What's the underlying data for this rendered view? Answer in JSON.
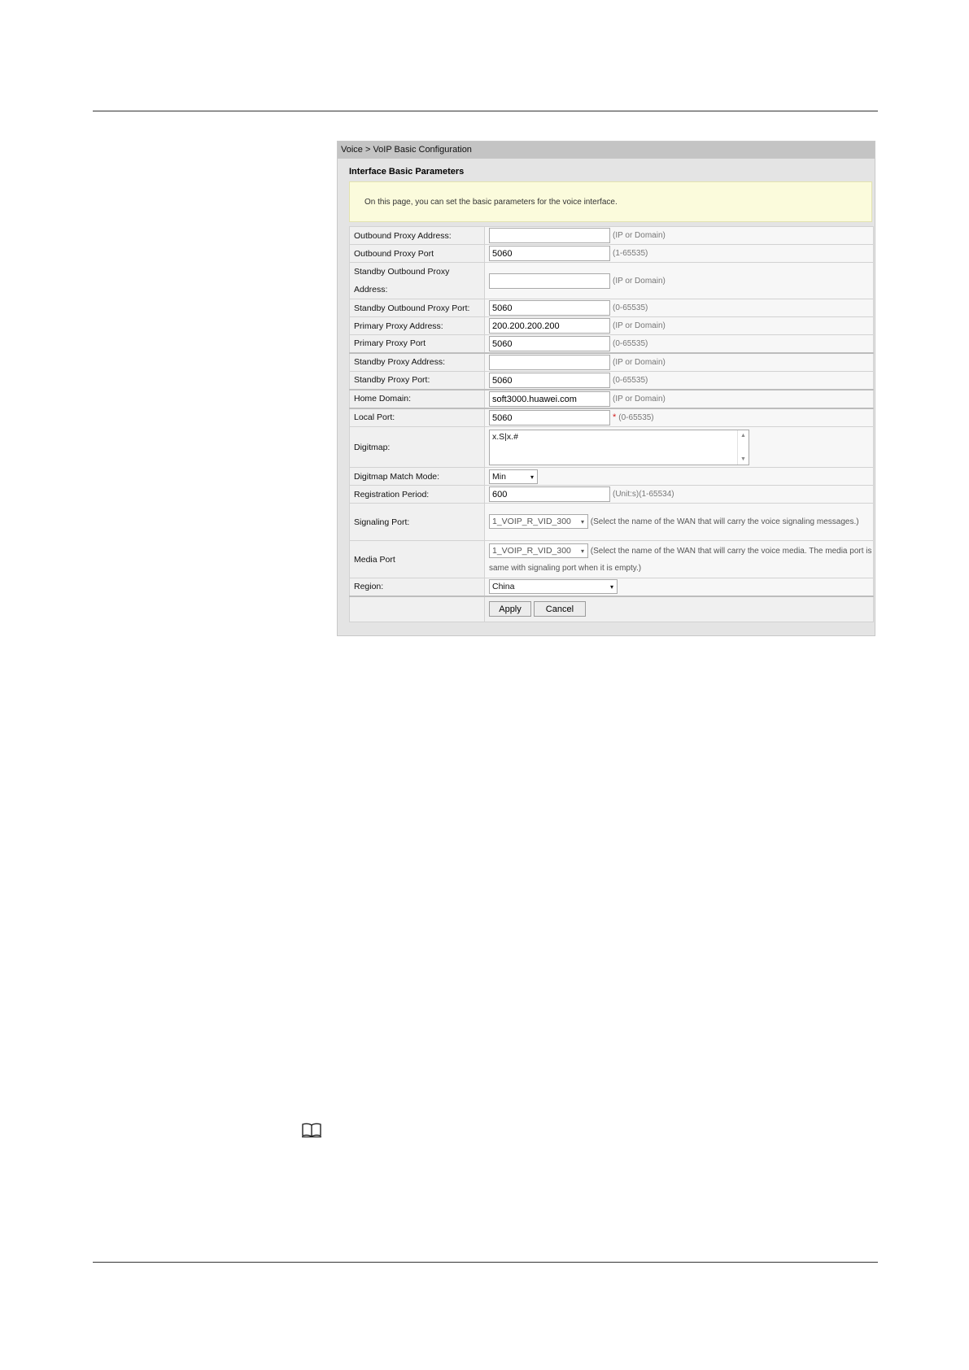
{
  "breadcrumb": "Voice > VoIP Basic Configuration",
  "section_title": "Interface Basic Parameters",
  "note": "On this page, you can set the basic parameters for the voice interface.",
  "fields": {
    "outbound_proxy_address": {
      "label": "Outbound Proxy Address:",
      "value": "",
      "hint": "(IP or Domain)"
    },
    "outbound_proxy_port": {
      "label": "Outbound Proxy Port",
      "value": "5060",
      "hint": "(1-65535)"
    },
    "standby_outbound_proxy_address": {
      "label_line1": "Standby Outbound Proxy",
      "label_line2": "Address:",
      "value": "",
      "hint": "(IP or Domain)"
    },
    "standby_outbound_proxy_port": {
      "label": "Standby Outbound Proxy Port:",
      "value": "5060",
      "hint": "(0-65535)"
    },
    "primary_proxy_address": {
      "label": "Primary Proxy Address:",
      "value": "200.200.200.200",
      "hint": "(IP or Domain)"
    },
    "primary_proxy_port": {
      "label": "Primary Proxy Port",
      "value": "5060",
      "hint": "(0-65535)"
    },
    "standby_proxy_address": {
      "label": "Standby Proxy Address:",
      "value": "",
      "hint": "(IP or Domain)"
    },
    "standby_proxy_port": {
      "label": "Standby Proxy Port:",
      "value": "5060",
      "hint": "(0-65535)"
    },
    "home_domain": {
      "label": "Home Domain:",
      "value": "soft3000.huawei.com",
      "hint": "(IP or Domain)"
    },
    "local_port": {
      "label": "Local Port:",
      "value": "5060",
      "required": "*",
      "hint": "(0-65535)"
    },
    "digitmap": {
      "label": "Digitmap:",
      "value": "x.S|x.#"
    },
    "digitmap_match_mode": {
      "label": "Digitmap Match Mode:",
      "value": "Min"
    },
    "registration_period": {
      "label": "Registration Period:",
      "value": "600",
      "hint": "(Unit:s)(1-65534)"
    },
    "signaling_port": {
      "label": "Signaling Port:",
      "value": "1_VOIP_R_VID_300",
      "hint": "(Select the name of the WAN that will carry the voice signaling messages.)"
    },
    "media_port": {
      "label": "Media Port",
      "value": "1_VOIP_R_VID_300",
      "hint": "(Select the name of the WAN that will carry the voice media. The media port is same with signaling port when it is empty.)"
    },
    "region": {
      "label": "Region:",
      "value": "China"
    }
  },
  "buttons": {
    "apply": "Apply",
    "cancel": "Cancel"
  },
  "icons": {
    "note_icon": "book-icon",
    "select_arrow": "▾"
  }
}
